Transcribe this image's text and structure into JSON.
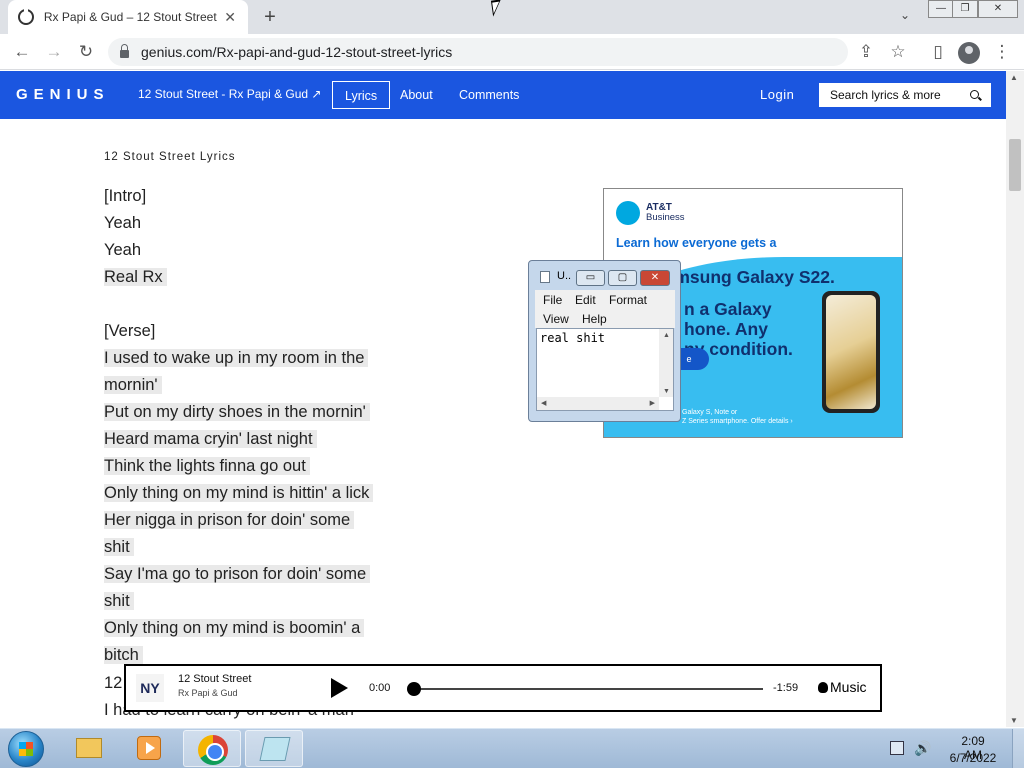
{
  "browser": {
    "tab_title": "Rx Papi & Gud – 12 Stout Street",
    "tab_close": "✕",
    "new_tab": "+",
    "tab_menu": "⌄",
    "url": "genius.com/Rx-papi-and-gud-12-stout-street-lyrics",
    "back": "←",
    "forward": "→",
    "reload": "↻",
    "share": "⇪",
    "bookmark": "☆",
    "sidepanel": "▯",
    "menu": "⋮",
    "win_min": "—",
    "win_restore": "❐",
    "win_close": "✕"
  },
  "genius_nav": {
    "logo": "GENIUS",
    "song": "12 Stout Street - Rx Papi & Gud ↗",
    "tabs": [
      {
        "label": "Lyrics"
      },
      {
        "label": "About"
      },
      {
        "label": "Comments"
      }
    ],
    "login": "Login",
    "search_placeholder": "Search lyrics & more"
  },
  "lyrics": {
    "heading": "12 Stout Street Lyrics",
    "lines": [
      "[Intro]",
      "Yeah",
      "Yeah",
      "Real Rx",
      "",
      "[Verse]",
      "I used to wake up in my room in the",
      "mornin'",
      "Put on my dirty shoes in the mornin'",
      "Heard mama cryin' last night",
      "Think the lights finna go out",
      "Only thing on my mind is hittin' a lick",
      "Her nigga in prison for doin' some",
      "shit",
      "Say I'ma go to prison for doin' some",
      "shit",
      "Only thing on my mind is boomin' a",
      "bitch"
    ],
    "partial_lines": [
      "12",
      "I had to learn carry on bein' a man"
    ]
  },
  "ad": {
    "brand_line1": "AT&T",
    "brand_line2": "Business",
    "headline": "Learn how everyone gets a",
    "big_lines": [
      "free Samsung Galaxy S22.",
      "n a Galaxy",
      "hone. Any",
      "ny condition."
    ],
    "cta": "e",
    "fine_line1": "Galaxy S, Note or",
    "fine_line2": "Z Series smartphone. Offer details ›"
  },
  "notepad": {
    "title": "U..",
    "menu": [
      "File",
      "Edit",
      "Format",
      "View",
      "Help"
    ],
    "content": "real shit",
    "min": "▭",
    "max": "▢",
    "close": "✕"
  },
  "player": {
    "title": "12 Stout Street",
    "artist": "Rx Papi & Gud",
    "art_glyph": "NY",
    "elapsed": "0:00",
    "remaining": "-1:59",
    "progress": 0,
    "brand": "Music",
    "brand_prefix": ""
  },
  "taskbar": {
    "time": "2:09 AM",
    "date": "6/7/2022",
    "volume": "🔊"
  },
  "scroll": {
    "up": "▲",
    "down": "▼"
  },
  "colors": {
    "genius_blue": "#1b56e0",
    "att_blue": "#0b6ad4",
    "ad_wave": "#38bdf0"
  }
}
